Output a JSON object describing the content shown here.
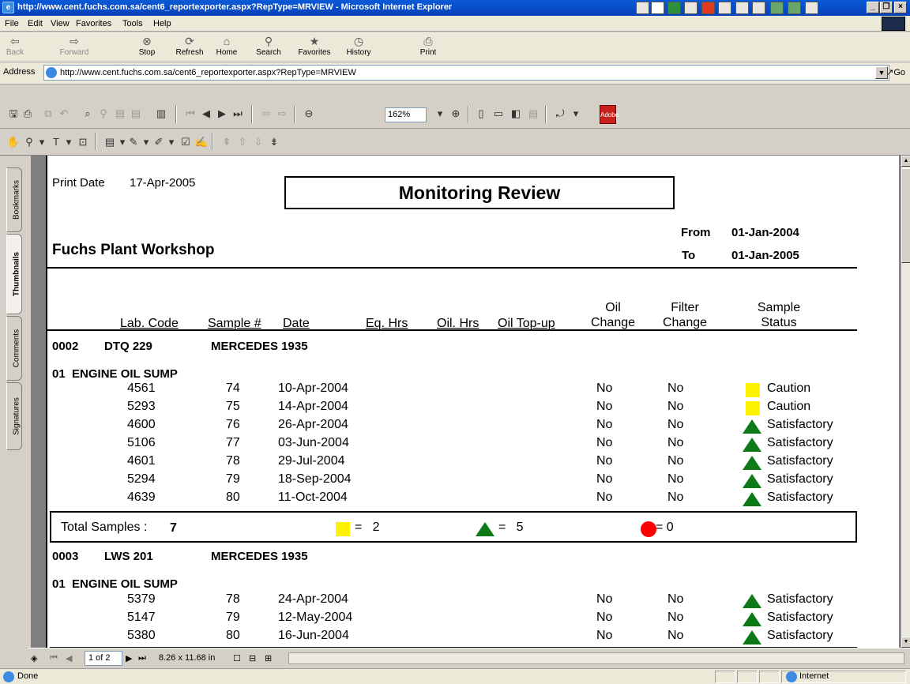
{
  "browser": {
    "title": "http://www.cent.fuchs.com.sa/cent6_reportexporter.aspx?RepType=MRVIEW - Microsoft Internet Explorer",
    "menu": [
      "File",
      "Edit",
      "View",
      "Favorites",
      "Tools",
      "Help"
    ],
    "toolbar": {
      "back": "Back",
      "forward": "Forward",
      "stop": "Stop",
      "refresh": "Refresh",
      "home": "Home",
      "search": "Search",
      "favorites": "Favorites",
      "history": "History",
      "print": "Print"
    },
    "address_label": "Address",
    "address_value": "http://www.cent.fuchs.com.sa/cent6_reportexporter.aspx?RepType=MRVIEW",
    "go_label": "Go",
    "status_text": "Done",
    "zone_text": "Internet"
  },
  "acrobat": {
    "zoom": "162%",
    "side_tabs": [
      "Bookmarks",
      "Thumbnails",
      "Comments",
      "Signatures"
    ],
    "active_tab": "Thumbnails",
    "page_indicator": "1 of 2",
    "page_size": "8.26 x 11.68 in",
    "adobe_logo_text": "Adobe"
  },
  "report": {
    "print_date_label": "Print Date",
    "print_date": "17-Apr-2005",
    "title": "Monitoring Review",
    "workshop": "Fuchs Plant Workshop",
    "from_label": "From",
    "from_date": "01-Jan-2004",
    "to_label": "To",
    "to_date": "01-Jan-2005",
    "columns": {
      "lab_code": "Lab. Code",
      "sample_no": "Sample #",
      "date": "Date",
      "eq_hrs": "Eq. Hrs",
      "oil_hrs": "Oil. Hrs",
      "oil_topup": "Oil Top-up",
      "oil_change_1": "Oil",
      "oil_change_2": "Change",
      "filter_change_1": "Filter",
      "filter_change_2": "Change",
      "sample_status_1": "Sample",
      "sample_status_2": "Status"
    },
    "colors": {
      "caution": "#fff200",
      "satisfactory": "#0b7a17",
      "critical": "#ff0000"
    },
    "groups": [
      {
        "unit_code": "0002",
        "reg": "DTQ 229",
        "model": "MERCEDES 1935",
        "component": "01  ENGINE OIL SUMP",
        "rows": [
          {
            "lab": "4561",
            "sample": "74",
            "date": "10-Apr-2004",
            "oil": "No",
            "filter": "No",
            "status": "Caution",
            "status_icon": "yellow-square-icon"
          },
          {
            "lab": "5293",
            "sample": "75",
            "date": "14-Apr-2004",
            "oil": "No",
            "filter": "No",
            "status": "Caution",
            "status_icon": "yellow-square-icon"
          },
          {
            "lab": "4600",
            "sample": "76",
            "date": "26-Apr-2004",
            "oil": "No",
            "filter": "No",
            "status": "Satisfactory",
            "status_icon": "green-triangle-icon"
          },
          {
            "lab": "5106",
            "sample": "77",
            "date": "03-Jun-2004",
            "oil": "No",
            "filter": "No",
            "status": "Satisfactory",
            "status_icon": "green-triangle-icon"
          },
          {
            "lab": "4601",
            "sample": "78",
            "date": "29-Jul-2004",
            "oil": "No",
            "filter": "No",
            "status": "Satisfactory",
            "status_icon": "green-triangle-icon"
          },
          {
            "lab": "5294",
            "sample": "79",
            "date": "18-Sep-2004",
            "oil": "No",
            "filter": "No",
            "status": "Satisfactory",
            "status_icon": "green-triangle-icon"
          },
          {
            "lab": "4639",
            "sample": "80",
            "date": "11-Oct-2004",
            "oil": "No",
            "filter": "No",
            "status": "Satisfactory",
            "status_icon": "green-triangle-icon"
          }
        ],
        "total_label": "Total Samples :",
        "total": "7",
        "caution_count": "=   2",
        "satisfactory_count": "=   5",
        "critical_count": "= 0"
      },
      {
        "unit_code": "0003",
        "reg": "LWS 201",
        "model": "MERCEDES 1935",
        "component": "01  ENGINE OIL SUMP",
        "rows": [
          {
            "lab": "5379",
            "sample": "78",
            "date": "24-Apr-2004",
            "oil": "No",
            "filter": "No",
            "status": "Satisfactory",
            "status_icon": "green-triangle-icon"
          },
          {
            "lab": "5147",
            "sample": "79",
            "date": "12-May-2004",
            "oil": "No",
            "filter": "No",
            "status": "Satisfactory",
            "status_icon": "green-triangle-icon"
          },
          {
            "lab": "5380",
            "sample": "80",
            "date": "16-Jun-2004",
            "oil": "No",
            "filter": "No",
            "status": "Satisfactory",
            "status_icon": "green-triangle-icon"
          }
        ]
      }
    ]
  }
}
